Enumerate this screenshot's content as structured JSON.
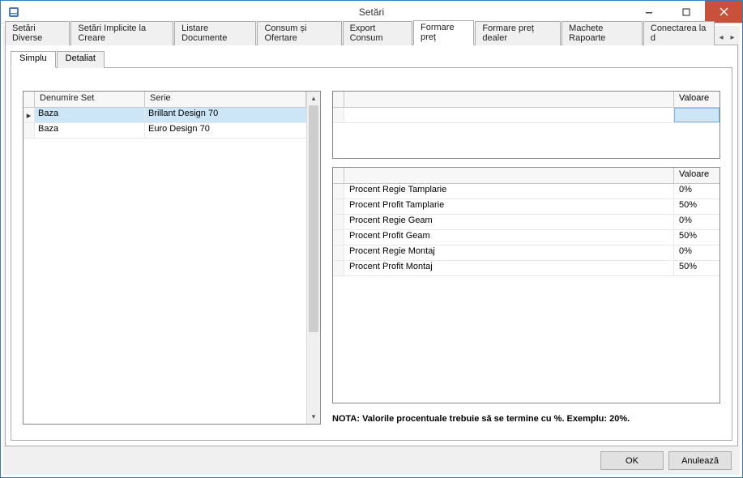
{
  "window": {
    "title": "Setări"
  },
  "tabs": {
    "items": [
      "Setări Diverse",
      "Setări Implicite la Creare",
      "Listare Documente",
      "Consum și Ofertare",
      "Export Consum",
      "Formare preț",
      "Formare preț dealer",
      "Machete Rapoarte",
      "Conectarea la d"
    ],
    "active_index": 5
  },
  "subtabs": {
    "items": [
      "Simplu",
      "Detaliat"
    ],
    "active_index": 0
  },
  "left_grid": {
    "headers": {
      "col0": "",
      "col1": "Denumire Set",
      "col2": "Serie"
    },
    "rows": [
      {
        "den": "Baza",
        "serie": "Brillant Design 70",
        "selected": true
      },
      {
        "den": "Baza",
        "serie": "Euro Design 70",
        "selected": false
      }
    ]
  },
  "top_grid": {
    "value_header": "Valoare",
    "rows": [
      {
        "label": "",
        "value": ""
      }
    ]
  },
  "bottom_grid": {
    "value_header": "Valoare",
    "rows": [
      {
        "label": "Procent Regie Tamplarie",
        "value": "0%"
      },
      {
        "label": "Procent Profit Tamplarie",
        "value": "50%"
      },
      {
        "label": "Procent Regie Geam",
        "value": "0%"
      },
      {
        "label": "Procent Profit Geam",
        "value": "50%"
      },
      {
        "label": "Procent Regie Montaj",
        "value": "0%"
      },
      {
        "label": "Procent Profit Montaj",
        "value": "50%"
      }
    ]
  },
  "note": "NOTA: Valorile procentuale trebuie să se termine cu %. Exemplu: 20%.",
  "buttons": {
    "ok": "OK",
    "cancel": "Anulează"
  }
}
